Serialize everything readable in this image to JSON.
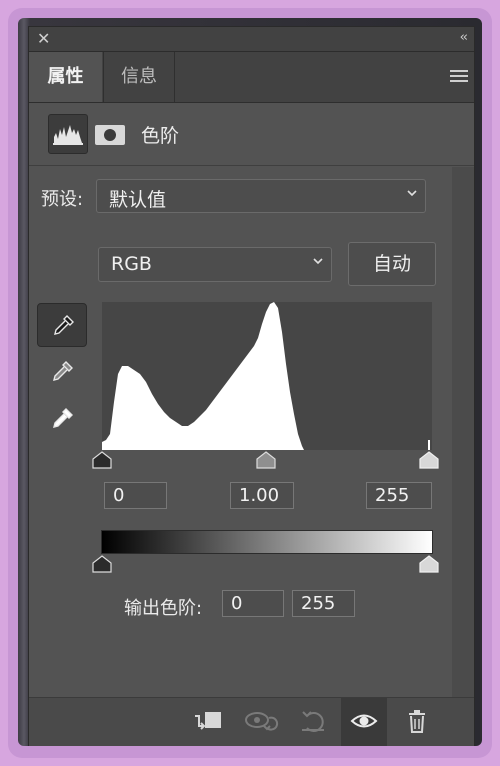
{
  "panel": {
    "close_glyph": "✕",
    "collapse_glyph": "‹‹",
    "tabs": [
      {
        "label": "属性",
        "active": true
      },
      {
        "label": "信息",
        "active": false
      }
    ],
    "menu_icon": "hamburger-menu-icon"
  },
  "header": {
    "adjustment_icon": "levels-histogram-icon",
    "mask_icon": "layer-mask-icon",
    "title": "色阶"
  },
  "preset": {
    "label": "预设:",
    "value": "默认值"
  },
  "channel": {
    "value": "RGB",
    "auto_label": "自动"
  },
  "droppers": [
    "black-point-eyedropper-icon",
    "gray-point-eyedropper-icon",
    "white-point-eyedropper-icon"
  ],
  "input_levels": {
    "black": "0",
    "gamma": "1.00",
    "white": "255"
  },
  "output_levels": {
    "label": "输出色阶:",
    "black": "0",
    "white": "255"
  },
  "footer_icons": [
    "clip-to-layer-icon",
    "view-previous-state-icon",
    "reset-icon",
    "visibility-eye-icon",
    "trash-icon"
  ],
  "colors": {
    "panel_bg": "#535353",
    "frame_bg": "#d7a6df",
    "histogram_fill": "#ffffff"
  }
}
